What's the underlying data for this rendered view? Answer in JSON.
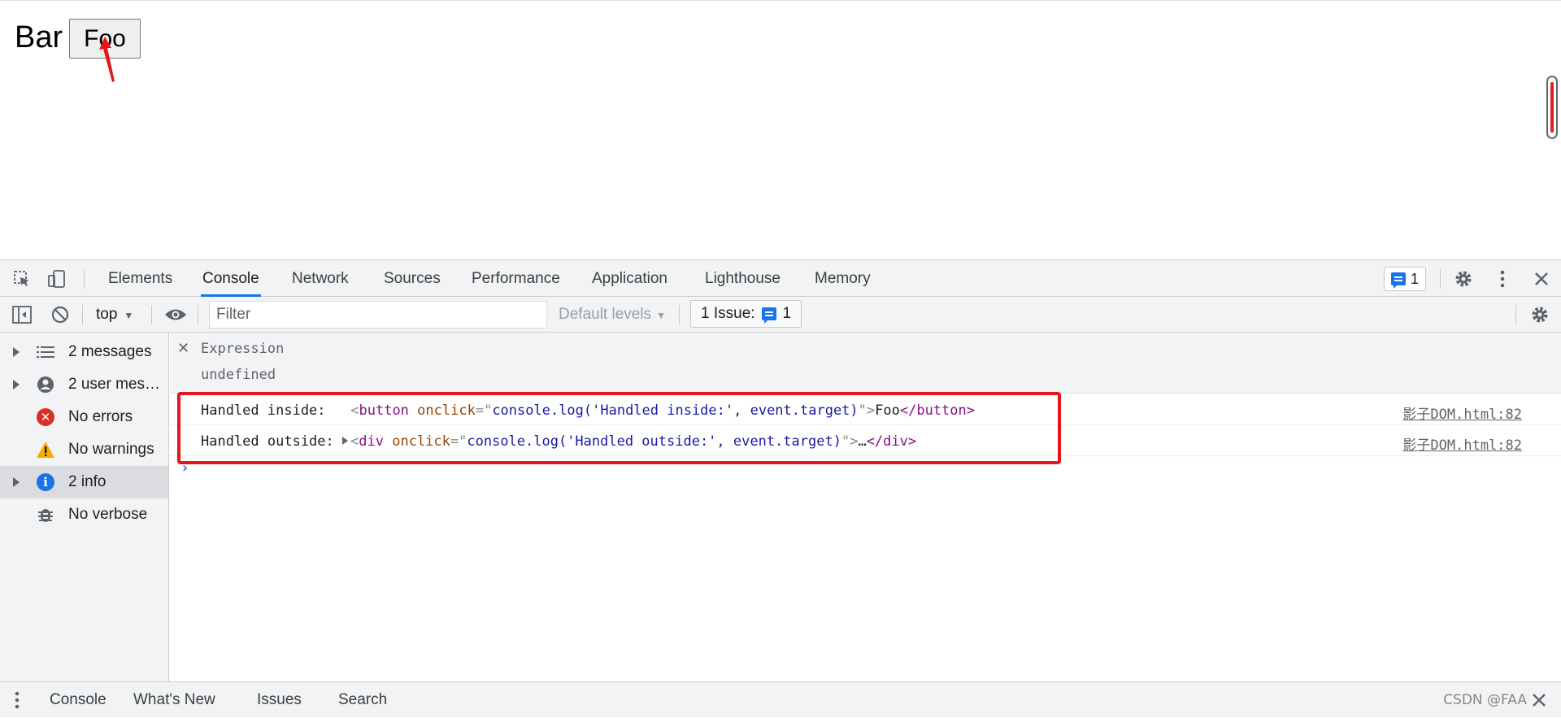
{
  "page": {
    "bar_text": "Bar",
    "button_label": "Foo",
    "arrow_color": "#e4161c"
  },
  "devtools": {
    "tabs": [
      "Elements",
      "Console",
      "Network",
      "Sources",
      "Performance",
      "Application",
      "Lighthouse",
      "Memory"
    ],
    "active_tab": "Console",
    "message_badge_count": "1",
    "toolbar": {
      "context": "top",
      "filter_placeholder": "Filter",
      "levels": "Default levels",
      "issue_label": "1 Issue:",
      "issue_count": "1"
    },
    "sidebar": [
      {
        "label": "2 messages",
        "icon": "list-icon"
      },
      {
        "label": "2 user messages",
        "icon": "user-icon"
      },
      {
        "label": "No errors",
        "icon": "error-icon"
      },
      {
        "label": "No warnings",
        "icon": "warning-icon"
      },
      {
        "label": "2 info",
        "icon": "info-icon",
        "selected": true
      },
      {
        "label": "No verbose",
        "icon": "bug-icon"
      }
    ],
    "console": {
      "expression_label": "Expression",
      "expression_value": "undefined",
      "logs": [
        {
          "label": "Handled inside:",
          "open_tag": "button",
          "attr_name": "onclick",
          "attr_value": "console.log('Handled inside:', event.target)",
          "inner": "Foo",
          "close_tag": "</button>",
          "source": "影子DOM.html:82"
        },
        {
          "label": "Handled outside:",
          "open_tag": "div",
          "attr_name": "onclick",
          "attr_value": "console.log('Handled outside:', event.target)",
          "inner": "…",
          "close_tag": "</div>",
          "source": "影子DOM.html:82"
        }
      ],
      "prompt": "›",
      "highlight_color": "#e4161c"
    },
    "drawer_tabs": [
      "Console",
      "What's New",
      "Issues",
      "Search"
    ],
    "watermark": "CSDN @FAA"
  }
}
